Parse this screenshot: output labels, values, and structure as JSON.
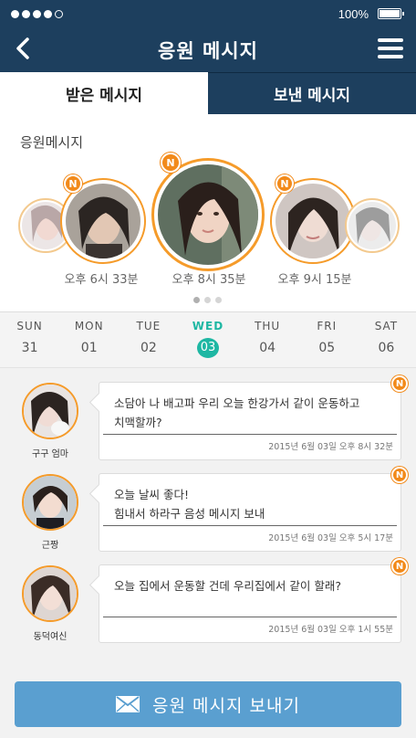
{
  "status_bar": {
    "battery": "100%"
  },
  "header": {
    "title": "응원 메시지"
  },
  "tabs": [
    {
      "label": "받은 메시지",
      "active": true
    },
    {
      "label": "보낸 메시지",
      "active": false
    }
  ],
  "cheer": {
    "title": "응원메시지",
    "badge": "N",
    "times": [
      "오후 6시 33분",
      "오후 8시 35분",
      "오후 9시 15분"
    ],
    "page_count": 3,
    "active_page": 1
  },
  "week": [
    {
      "name": "SUN",
      "num": "31"
    },
    {
      "name": "MON",
      "num": "01"
    },
    {
      "name": "TUE",
      "num": "02"
    },
    {
      "name": "WED",
      "num": "03",
      "active": true
    },
    {
      "name": "THU",
      "num": "04"
    },
    {
      "name": "FRI",
      "num": "05"
    },
    {
      "name": "SAT",
      "num": "06"
    }
  ],
  "messages": [
    {
      "name": "구구 엄마",
      "text": "소담아 나 배고파 우리 오늘 한강가서 같이 운동하고\n치맥할까?",
      "time": "2015년 6월 03일 오후 8시 32분",
      "badge": "N"
    },
    {
      "name": "근짱",
      "text": "오늘 날씨 좋다!\n힘내서 하라구 음성 메시지 보내",
      "time": "2015년 6월 03일 오후 5시 17분",
      "badge": "N"
    },
    {
      "name": "동덕여신",
      "text": "오늘 집에서 운동할 건데 우리집에서 같이 할래?",
      "time": "2015년 6월 03일 오후 1시 55분",
      "badge": "N"
    }
  ],
  "send_button": {
    "label": "응원 메시지 보내기",
    "icon": "envelope-icon"
  },
  "colors": {
    "header": "#1d3f5e",
    "accent": "#f28a1a",
    "active_day": "#1eb7a3",
    "button": "#5a9fd0"
  }
}
